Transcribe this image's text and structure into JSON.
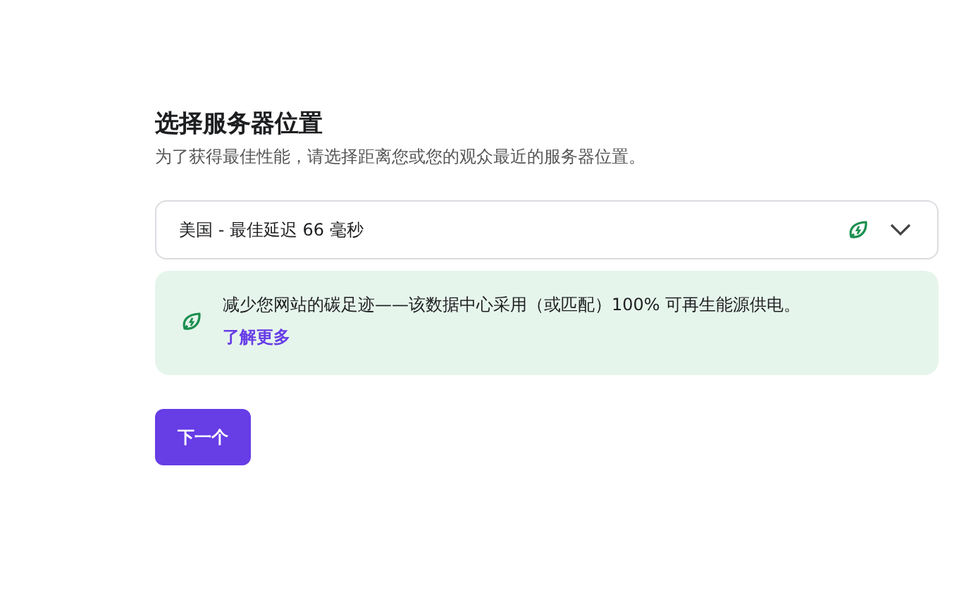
{
  "heading": "选择服务器位置",
  "subtitle": "为了获得最佳性能，请选择距离您或您的观众最近的服务器位置。",
  "location_select": {
    "value": "美国 - 最佳延迟 66 毫秒",
    "green": true
  },
  "notice": {
    "text": "减少您网站的碳足迹——该数据中心采用（或匹配）100% 可再生能源供电。",
    "link": "了解更多"
  },
  "buttons": [
    "下一个"
  ]
}
